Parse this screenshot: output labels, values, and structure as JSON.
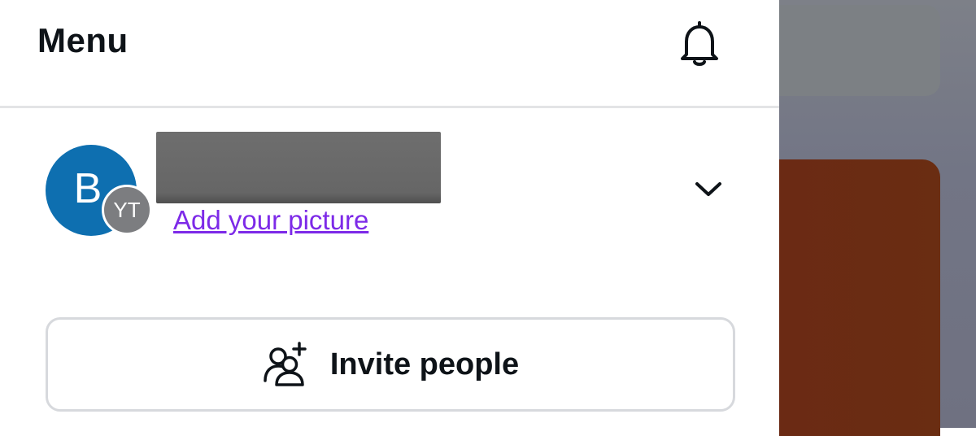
{
  "menu": {
    "title": "Menu"
  },
  "icons": {
    "notifications": "bell-icon",
    "expand": "chevron-down-icon",
    "invite": "add-people-icon"
  },
  "profile": {
    "avatar_initial": "B",
    "team_initials": "YT",
    "add_picture_label": "Add your picture",
    "avatar_color": "#0e6fb0",
    "team_badge_color": "#7c7d80",
    "link_color": "#7d2ae8"
  },
  "actions": {
    "invite_label": "Invite people"
  }
}
